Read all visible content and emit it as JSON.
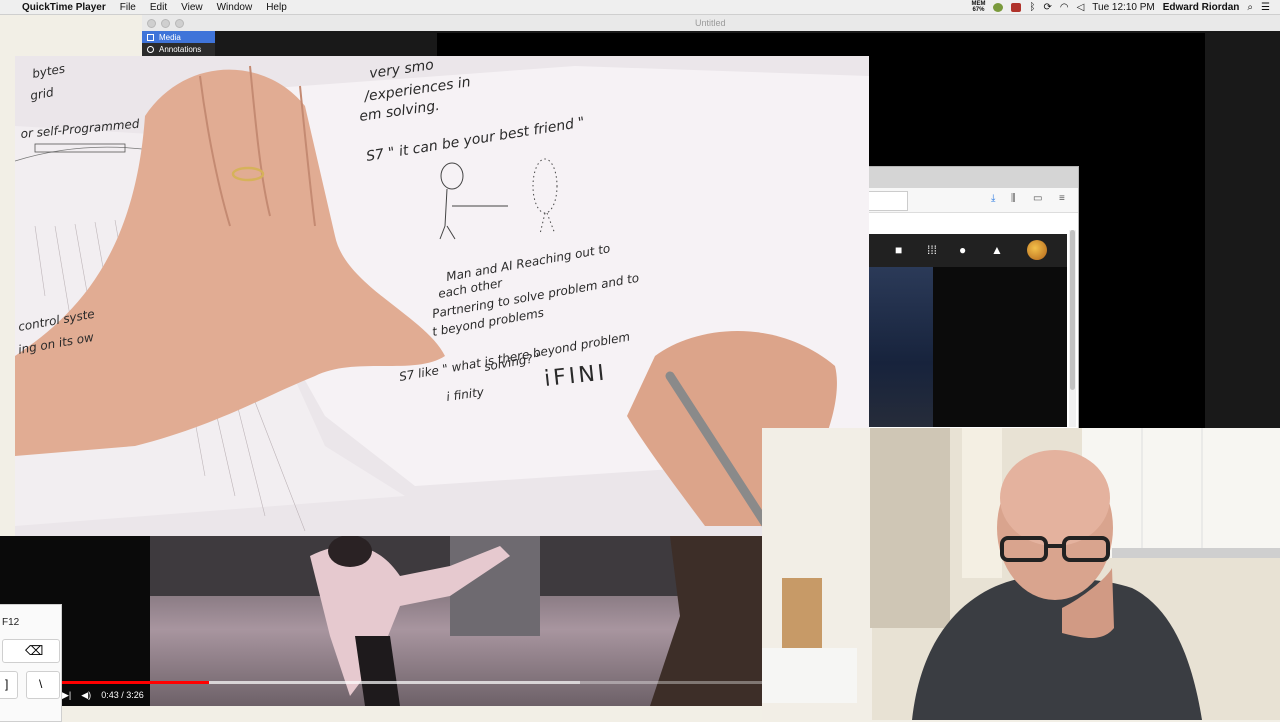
{
  "menubar": {
    "app_name": "QuickTime Player",
    "menus": [
      "File",
      "Edit",
      "View",
      "Window",
      "Help"
    ],
    "memory_label": "MEM",
    "memory_value": "67%",
    "clock": "Tue 12:10 PM",
    "user": "Edward Riordan"
  },
  "window": {
    "title": "Untitled"
  },
  "sidebar": {
    "items": [
      {
        "label": "Media",
        "selected": true
      },
      {
        "label": "Annotations",
        "selected": false
      }
    ]
  },
  "sketch_text": {
    "line1": "very smo",
    "line2": "/experiences in",
    "line3": "em solving.",
    "line4": "S7 \" it can be your best friend \"",
    "line5": "Man and AI Reaching out to",
    "line6": "each other",
    "line7": "Partnering to solve problem and to",
    "line8": "t beyond problems",
    "line9": "S7  like \" what is there beyond problem",
    "line10": "solving? \"",
    "line11": "i finity",
    "line12": "iFINI",
    "left1": "bytes",
    "left2": "grid",
    "left3": "or self-Programmed",
    "left4": "control syste",
    "left5": "ing on its ow"
  },
  "video_player": {
    "time": "0:43 / 3:26",
    "progress": 0.21,
    "buffered_to": 0.74
  },
  "keyboard": {
    "keys": [
      "F12",
      "]",
      "\\"
    ]
  },
  "colors": {
    "accent_blue": "#3f74d9",
    "youtube_red": "#ff0000",
    "sketch_ink": "#2a2a2a"
  }
}
